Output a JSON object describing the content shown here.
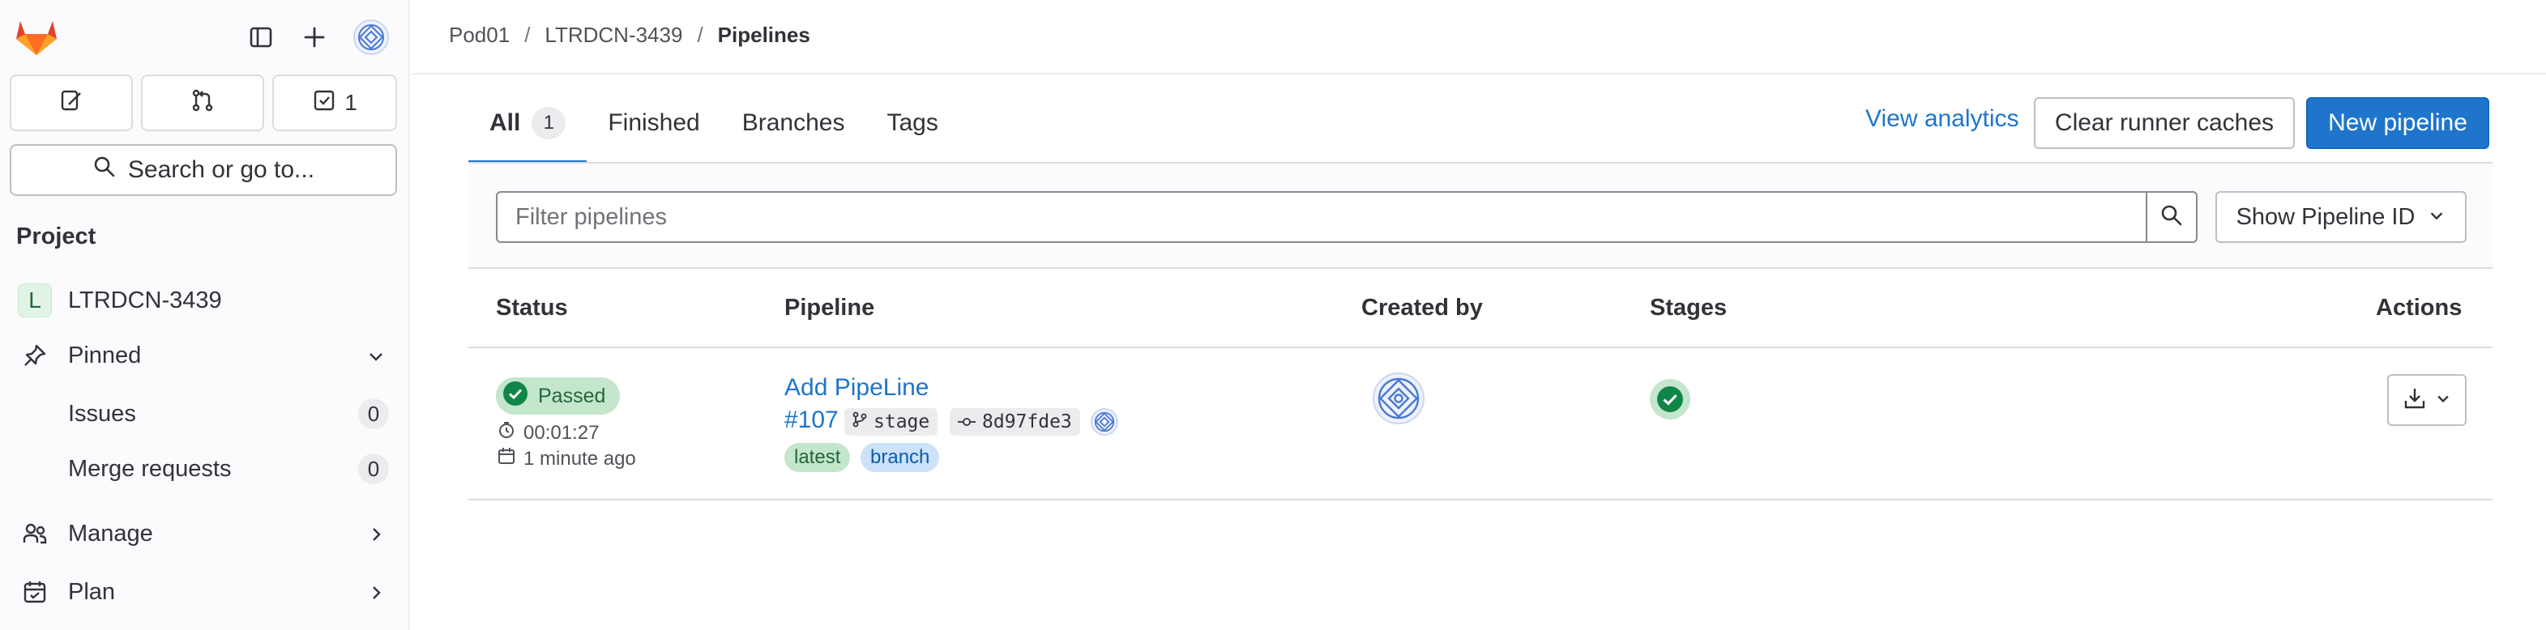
{
  "sidebar": {
    "todo_count": "1",
    "search_label": "Search or go to...",
    "section_title": "Project",
    "project": {
      "letter": "L",
      "name": "LTRDCN-3439"
    },
    "pinned_label": "Pinned",
    "pinned_items": [
      {
        "label": "Issues",
        "count": "0"
      },
      {
        "label": "Merge requests",
        "count": "0"
      }
    ],
    "manage_label": "Manage",
    "plan_label": "Plan"
  },
  "breadcrumb": {
    "items": [
      "Pod01",
      "LTRDCN-3439",
      "Pipelines"
    ],
    "separator": "/"
  },
  "tabs": [
    {
      "label": "All",
      "count": "1"
    },
    {
      "label": "Finished"
    },
    {
      "label": "Branches"
    },
    {
      "label": "Tags"
    }
  ],
  "actions": {
    "analytics_label": "View analytics",
    "clear_cache_label": "Clear runner caches",
    "new_pipeline_label": "New pipeline"
  },
  "filter": {
    "placeholder": "Filter pipelines",
    "dropdown_label": "Show Pipeline ID"
  },
  "table": {
    "headers": {
      "status": "Status",
      "pipeline": "Pipeline",
      "created_by": "Created by",
      "stages": "Stages",
      "actions": "Actions"
    },
    "rows": [
      {
        "status": "Passed",
        "duration": "00:01:27",
        "finished": "1 minute ago",
        "title": "Add PipeLine",
        "id": "#107",
        "ref": "stage",
        "commit": "8d97fde3",
        "tags": [
          "latest",
          "branch"
        ]
      }
    ]
  },
  "colors": {
    "accent": "#1f75cb",
    "success_bg": "#c3e6cd",
    "success_fg": "#108548",
    "tag_blue_bg": "#cbe2f9"
  },
  "icons": {
    "logo": "gitlab-tanuki-icon",
    "sidebar_toggle": "sidebar-toggle-icon",
    "create": "plus-icon",
    "issues": "issues-icon",
    "merge_requests": "merge-request-icon",
    "todos": "todo-check-icon",
    "search": "search-icon",
    "pin": "pin-icon",
    "manage": "users-icon",
    "plan": "calendar-icon",
    "download": "download-icon"
  }
}
